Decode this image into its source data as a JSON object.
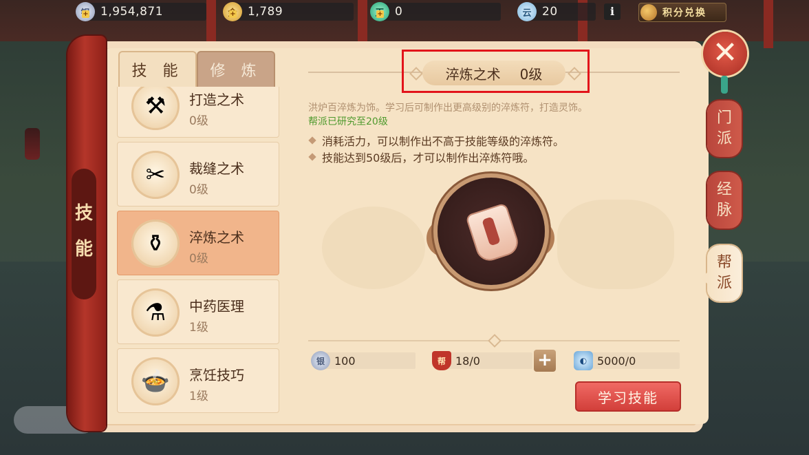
{
  "currencies": {
    "silver": {
      "value": "1,954,871"
    },
    "gold": {
      "value": "1,789"
    },
    "jade": {
      "value": "0"
    },
    "cloud": {
      "value": "20"
    },
    "exchange_label": "积分兑换"
  },
  "spine_label": [
    "技",
    "能"
  ],
  "tabs": {
    "skill": "技 能",
    "train": "修 炼"
  },
  "skills": [
    {
      "name": "打造之术",
      "level": "0级",
      "icon": "forge-icon"
    },
    {
      "name": "裁缝之术",
      "level": "0级",
      "icon": "tailor-icon"
    },
    {
      "name": "淬炼之术",
      "level": "0级",
      "icon": "refine-icon",
      "active": true
    },
    {
      "name": "中药医理",
      "level": "1级",
      "icon": "medicine-icon"
    },
    {
      "name": "烹饪技巧",
      "level": "1级",
      "icon": "cooking-icon"
    }
  ],
  "detail": {
    "title": "淬炼之术",
    "level": "0级",
    "description": "洪炉百淬炼为饰。学习后可制作出更高级别的淬炼符，打造灵饰。",
    "guild_research": "帮派已研究至20级",
    "bullets": [
      "消耗活力，可以制作出不高于技能等级的淬炼符。",
      "技能达到50级后，才可以制作出淬炼符哦。"
    ],
    "emblem_icon": "scroll-icon"
  },
  "costs": {
    "silver": "100",
    "guild_contribution": "18/0",
    "guild_badge": "帮",
    "energy": "5000/0"
  },
  "learn_button": "学习技能",
  "side_tabs": {
    "sect": [
      "门",
      "派"
    ],
    "meridian": [
      "经",
      "脉"
    ],
    "guild": [
      "帮",
      "派"
    ]
  },
  "colors": {
    "highlight_box": "#e2131a",
    "active_item": "#f1b58b",
    "learn_button": "#d23f3a",
    "guild_text": "#4f9a2e"
  }
}
